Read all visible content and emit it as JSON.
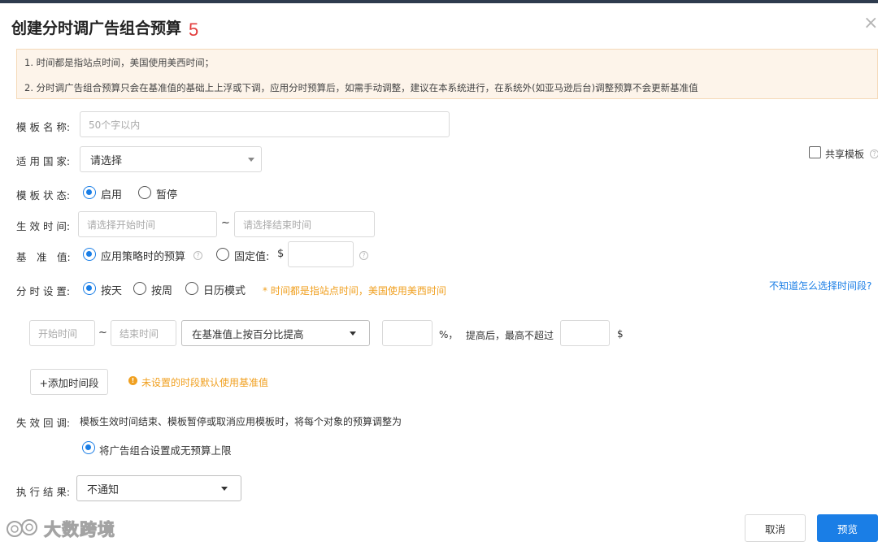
{
  "dialog": {
    "title": "创建分时调广告组合预算",
    "annotation_number": "5",
    "close_symbol": "×"
  },
  "notice": {
    "line1": "1. 时间都是指站点时间，美国使用美西时间；",
    "line2": "2. 分时调广告组合预算只会在基准值的基础上上浮或下调，应用分时预算后，如需手动调整，建议在本系统进行，在系统外(如亚马逊后台)调整预算不会更新基准值"
  },
  "form": {
    "template_name": {
      "label": "模 板 名 称:",
      "placeholder": "50个字以内"
    },
    "country": {
      "label": "适 用 国 家:",
      "value": "请选择"
    },
    "share": {
      "label": "共享模板",
      "checked": false
    },
    "status": {
      "label": "模 板 状 态:",
      "options": [
        "启用",
        "暂停"
      ],
      "selected": "启用"
    },
    "effective_time": {
      "label": "生 效 时 间:",
      "start_placeholder": "请选择开始时间",
      "separator": "~",
      "end_placeholder": "请选择结束时间"
    },
    "baseline": {
      "label": "基　准　值:",
      "options": [
        "应用策略时的预算",
        "固定值:"
      ],
      "selected": "应用策略时的预算",
      "currency": "$",
      "fixed_value": ""
    },
    "schedule": {
      "label": "分 时 设 置:",
      "options": [
        "按天",
        "按周",
        "日历模式"
      ],
      "selected": "按天",
      "note": "* 时间都是指站点时间，美国使用美西时间",
      "help_link": "不知道怎么选择时间段?"
    },
    "period_row": {
      "start_placeholder": "开始时间",
      "separator": "~",
      "end_placeholder": "结束时间",
      "mode": "在基准值上按百分比提高",
      "percent_value": "",
      "percent_suffix": "%，",
      "cap_label": "提高后，最高不超过",
      "cap_value": "",
      "cap_currency": "$"
    },
    "add_period_button": "+添加时间段",
    "unset_note": "未设置的时段默认使用基准值",
    "fallback": {
      "label": "失 效 回 调:",
      "description": "模板生效时间结束、模板暂停或取消应用模板时，将每个对象的预算调整为",
      "option": "将广告组合设置成无预算上限",
      "selected": true
    },
    "result": {
      "label": "执 行 结 果:",
      "value": "不通知"
    }
  },
  "footer": {
    "cancel": "取消",
    "preview": "预览"
  },
  "watermark": {
    "text": "大数跨境"
  },
  "colors": {
    "primary": "#1a7ee6",
    "warning": "#f0a020",
    "notice_bg": "#fdf4ea",
    "annotation": "#e23b3b"
  }
}
